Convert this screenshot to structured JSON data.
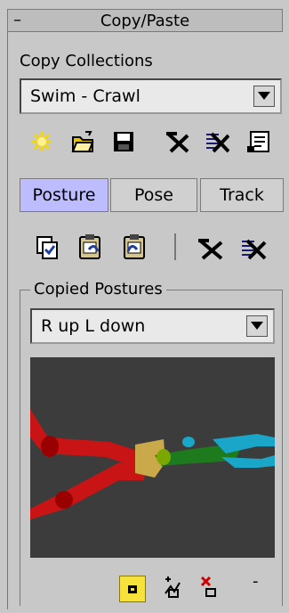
{
  "panel": {
    "title": "Copy/Paste",
    "collapse_symbol": "–"
  },
  "copy_collections": {
    "label": "Copy Collections",
    "selected": "Swim - Crawl"
  },
  "collection_tools": [
    "new-collection-icon",
    "load-collection-icon",
    "save-collection-icon",
    "delete-collection-icon",
    "delete-all-collections-icon",
    "max-script-icon"
  ],
  "tabs": [
    {
      "label": "Posture",
      "active": true
    },
    {
      "label": "Pose",
      "active": false
    },
    {
      "label": "Track",
      "active": false
    }
  ],
  "posture_tools": [
    "copy-posture-icon",
    "paste-posture-icon",
    "paste-opposite-icon",
    "delete-selected-icon",
    "delete-all-icon"
  ],
  "copied_postures": {
    "label": "Copied Postures",
    "selected": "R up L down"
  },
  "viewport": {
    "background": "#3c3c3c"
  },
  "bottom_tools": {
    "items": [
      "capture-icon",
      "add-icon",
      "remove-icon"
    ],
    "minus": "-"
  },
  "colors": {
    "panel_bg": "#c8c8c8",
    "active_tab": "#bcbcff",
    "accent_yellow": "#f7e23b"
  }
}
